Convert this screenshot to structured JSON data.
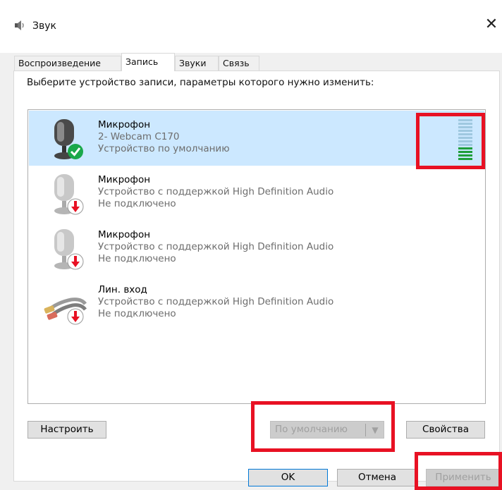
{
  "window": {
    "title": "Звук",
    "close_glyph": "✕"
  },
  "tabs": [
    {
      "label": "Воспроизведение",
      "active": false
    },
    {
      "label": "Запись",
      "active": true
    },
    {
      "label": "Звуки",
      "active": false
    },
    {
      "label": "Связь",
      "active": false
    }
  ],
  "instruction": "Выберите устройство записи, параметры которого нужно изменить:",
  "devices": [
    {
      "name": "Микрофон",
      "line2": "2- Webcam C170",
      "line3": "Устройство по умолчанию",
      "icon": "microphone-icon",
      "status_icon": "default-check-icon",
      "selected": true
    },
    {
      "name": "Микрофон",
      "line2": "Устройство с поддержкой High Definition Audio",
      "line3": "Не подключено",
      "icon": "microphone-icon",
      "status_icon": "disconnected-arrow-icon",
      "selected": false
    },
    {
      "name": "Микрофон",
      "line2": "Устройство с поддержкой High Definition Audio",
      "line3": "Не подключено",
      "icon": "microphone-icon",
      "status_icon": "disconnected-arrow-icon",
      "selected": false
    },
    {
      "name": "Лин. вход",
      "line2": "Устройство с поддержкой High Definition Audio",
      "line3": "Не подключено",
      "icon": "line-in-cable-icon",
      "status_icon": "disconnected-arrow-icon",
      "selected": false
    }
  ],
  "level_meter": {
    "level": 0.35
  },
  "buttons": {
    "configure": "Настроить",
    "set_default": "По умолчанию",
    "properties": "Свойства",
    "ok": "OK",
    "cancel": "Отмена",
    "apply": "Применить"
  },
  "colors": {
    "selection": "#cce8ff",
    "meter_active": "#1f9e3a",
    "meter_idle": "#9fc8e0",
    "highlight": "#e81123",
    "check": "#1aa84a",
    "disconnected": "#e81123"
  }
}
